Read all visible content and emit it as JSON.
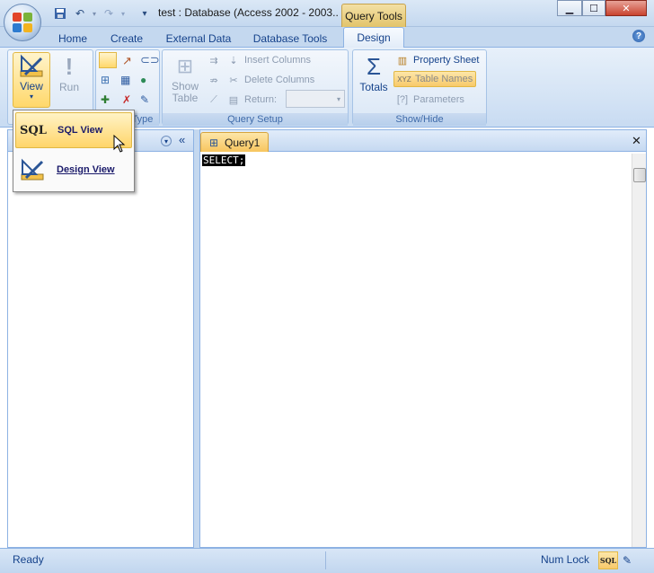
{
  "window": {
    "title": "test : Database (Access 2002 - 2003...",
    "context_tab": "Query Tools"
  },
  "quick_access": {
    "save_icon": "save-icon",
    "undo_icon": "undo-icon",
    "redo_icon": "redo-icon",
    "customize_icon": "dropdown-icon"
  },
  "tabs": [
    "Home",
    "Create",
    "External Data",
    "Database Tools",
    "Design"
  ],
  "ribbon": {
    "results": {
      "view_label": "View",
      "run_label": "Run"
    },
    "query_type": {
      "label": "Query Type"
    },
    "query_setup": {
      "label": "Query Setup",
      "show_table": "Show Table",
      "insert_columns": "Insert Columns",
      "delete_columns": "Delete Columns",
      "return_label": "Return:",
      "return_value": ""
    },
    "show_hide": {
      "label": "Show/Hide",
      "totals": "Totals",
      "property_sheet": "Property Sheet",
      "table_names": "Table Names",
      "parameters": "Parameters"
    }
  },
  "view_menu": {
    "items": [
      {
        "label": "SQL View",
        "icon": "sql-icon",
        "active": true
      },
      {
        "label": "Design View",
        "icon": "design-view-icon",
        "active": false
      }
    ]
  },
  "document": {
    "tab_label": "Query1",
    "sql_text": "SELECT;"
  },
  "status": {
    "left": "Ready",
    "num_lock": "Num Lock"
  }
}
